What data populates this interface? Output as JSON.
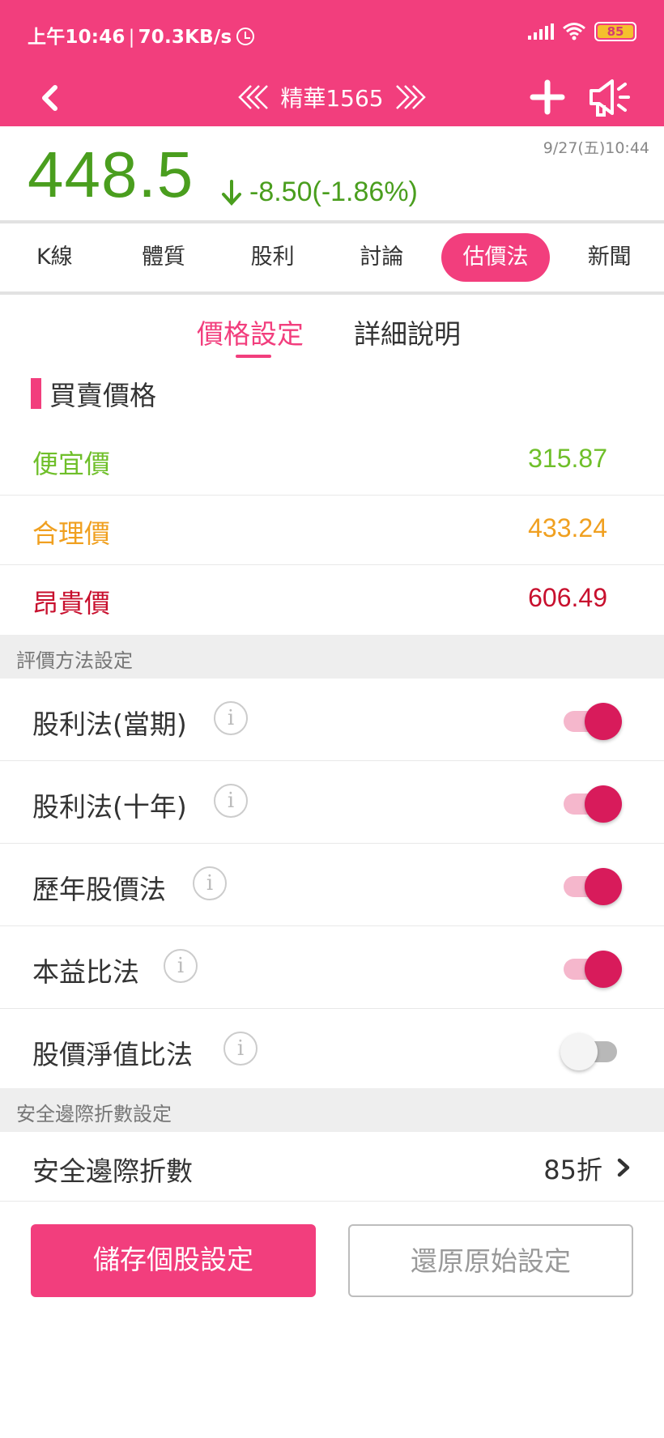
{
  "status_bar": {
    "time": "上午10:46",
    "speed": "70.3KB/s",
    "battery": "85"
  },
  "header": {
    "title": "精華1565"
  },
  "quote": {
    "price": "448.5",
    "change": "-8.50(-1.86%)",
    "timestamp": "9/27(五)10:44",
    "color": "#4a9e1e"
  },
  "tabs": [
    {
      "label": "K線"
    },
    {
      "label": "體質"
    },
    {
      "label": "股利"
    },
    {
      "label": "討論"
    },
    {
      "label": "估價法",
      "active": true
    },
    {
      "label": "新聞"
    }
  ],
  "subtabs": [
    {
      "label": "價格設定",
      "active": true
    },
    {
      "label": "詳細說明"
    }
  ],
  "section_title": "買賣價格",
  "prices": {
    "cheap": {
      "label": "便宜價",
      "value": "315.87",
      "color": "#6fbf2a"
    },
    "fair": {
      "label": "合理價",
      "value": "433.24",
      "color": "#f0a020"
    },
    "expensive": {
      "label": "昂貴價",
      "value": "606.49",
      "color": "#c8102e"
    }
  },
  "methods_header": "評價方法設定",
  "methods": [
    {
      "label": "股利法(當期)",
      "enabled": true
    },
    {
      "label": "股利法(十年)",
      "enabled": true
    },
    {
      "label": "歷年股價法",
      "enabled": true
    },
    {
      "label": "本益比法",
      "enabled": true
    },
    {
      "label": "股價淨值比法",
      "enabled": false
    }
  ],
  "margin_header": "安全邊際折數設定",
  "margin": {
    "label": "安全邊際折數",
    "value": "85折"
  },
  "buttons": {
    "save": "儲存個股設定",
    "reset": "還原原始設定"
  },
  "colors": {
    "accent": "#f23e7d",
    "toggle_on": "#d81b5b"
  }
}
